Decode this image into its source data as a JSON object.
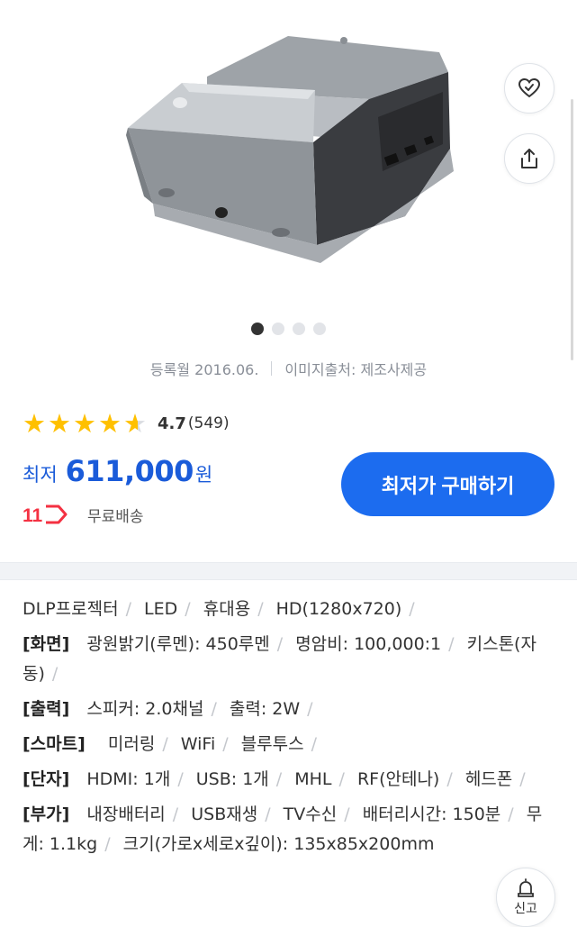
{
  "image_meta": {
    "registered": "등록월 2016.06.",
    "image_source": "이미지출처: 제조사제공"
  },
  "rating": {
    "score": "4.7",
    "count": "(549)",
    "value_out_of_5": 4.7
  },
  "price": {
    "prefix": "최저",
    "value": "611,000",
    "unit": "원"
  },
  "seller": {
    "logo_text": "11",
    "shipping": "무료배송"
  },
  "buy_button": {
    "label": "최저가 구매하기"
  },
  "report_button": {
    "label": "신고"
  },
  "colors": {
    "accent": "#1c6cef",
    "price": "#1a5bd9",
    "star": "#ffc000",
    "seller_logo": "#f43142"
  },
  "specs": {
    "tags": [
      "DLP프로젝터",
      "LED",
      "휴대용",
      "HD(1280x720)"
    ],
    "screen": {
      "label": "[화면]",
      "items": [
        "광원밝기(루멘): 450루멘",
        "명암비: 100,000:1",
        "키스톤(자동)"
      ]
    },
    "output": {
      "label": "[출력]",
      "items": [
        "스피커: 2.0채널",
        "출력: 2W"
      ]
    },
    "smart": {
      "label": "[스마트]",
      "items": [
        "미러링",
        "WiFi",
        "블루투스"
      ]
    },
    "ports": {
      "label": "[단자]",
      "items": [
        "HDMI: 1개",
        "USB: 1개",
        "MHL",
        "RF(안테나)",
        "헤드폰"
      ]
    },
    "extra": {
      "label": "[부가]",
      "items": [
        "내장배터리",
        "USB재생",
        "TV수신",
        "배터리시간: 150분",
        "무게: 1.1kg",
        "크기(가로x세로x깊이): 135x85x200mm"
      ]
    }
  },
  "icons": {
    "wish": "heart-check-icon",
    "share": "share-icon",
    "report": "siren-icon",
    "star": "star-icon"
  },
  "carousel": {
    "total": 4,
    "active": 1
  }
}
